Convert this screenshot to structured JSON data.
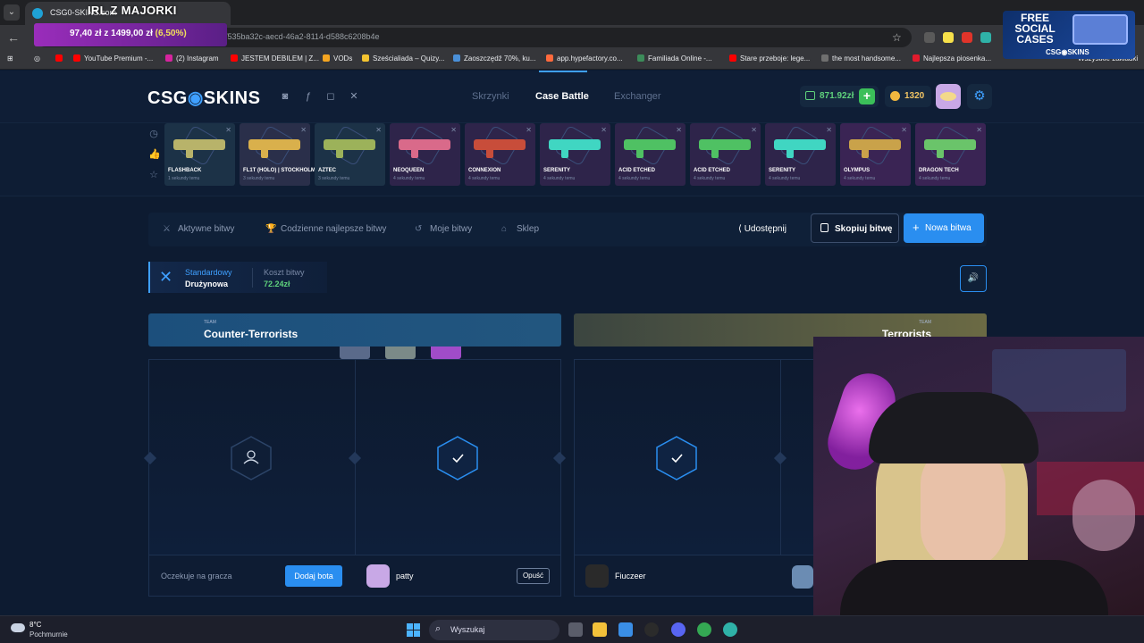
{
  "browser": {
    "tab_title": "CSG0-SKINS.com",
    "stream_overlay_title": "IRL Z MAJORKI",
    "url_partial": "battle/535ba32c-aecd-46a2-8114-d588c6208b4e",
    "donation": {
      "current": "97,40 zł",
      "mid": "z",
      "goal": "1499,00 zł",
      "percent": "(6,50%)"
    },
    "bookmarks": [
      {
        "label": "YouTube Premium -...",
        "color": "#ff0000"
      },
      {
        "label": "(2) Instagram",
        "color": "#d6249f"
      },
      {
        "label": "JESTEM DEBILEM | Z...",
        "color": "#ff0000"
      },
      {
        "label": "VODs",
        "color": "#f4a521"
      },
      {
        "label": "Sześcialiada – Quizy...",
        "color": "#f4c430"
      },
      {
        "label": "Zaoszczędź 70%, ku...",
        "color": "#4a90d9"
      },
      {
        "label": "app.hypefactory.co...",
        "color": "#ff6a3d"
      },
      {
        "label": "Familiada Online -...",
        "color": "#3c8c5a"
      },
      {
        "label": "Stare przeboje: lege...",
        "color": "#ff0000"
      },
      {
        "label": "the most handsome...",
        "color": "#6f6f6f"
      },
      {
        "label": "Najlepsza piosenka...",
        "color": "#e21b2d"
      }
    ],
    "bookmarks_all": "Wszystkie zakładki",
    "promo": {
      "line1": "FREE SOCIAL CASES",
      "brand": "CSG◉SKINS"
    }
  },
  "header": {
    "logo_left": "CSG",
    "logo_mid": "◉",
    "logo_right": "SKINS",
    "nav": [
      "Skrzynki",
      "Case Battle",
      "Exchanger"
    ],
    "balance": "871.92zł",
    "coins": "1320",
    "accent": "#3fa0ff"
  },
  "live_drops": [
    {
      "name": "FLASHBACK",
      "time": "1 sekundy temu",
      "color": "#b8b36a",
      "tint": "#1c3247"
    },
    {
      "name": "FL1T (HOLO) | STOCKHOLM 2021",
      "time": "3 sekundy temu",
      "color": "#d9b04c",
      "tint": "#2a2f4a"
    },
    {
      "name": "AZTEC",
      "time": "3 sekundy temu",
      "color": "#9cb25a",
      "tint": "#1c3247"
    },
    {
      "name": "NEOQUEEN",
      "time": "4 sekundy temu",
      "color": "#d96a8a",
      "tint": "#2e244a"
    },
    {
      "name": "CONNEXION",
      "time": "4 sekundy temu",
      "color": "#c84d3a",
      "tint": "#2e244a"
    },
    {
      "name": "SERENITY",
      "time": "4 sekundy temu",
      "color": "#40d6c2",
      "tint": "#2e244a"
    },
    {
      "name": "ACID ETCHED",
      "time": "4 sekundy temu",
      "color": "#4fc163",
      "tint": "#2e244a"
    },
    {
      "name": "ACID ETCHED",
      "time": "4 sekundy temu",
      "color": "#4fc163",
      "tint": "#2e244a"
    },
    {
      "name": "SERENITY",
      "time": "4 sekundy temu",
      "color": "#40d6c2",
      "tint": "#2e244a"
    },
    {
      "name": "OLYMPUS",
      "time": "4 sekundy temu",
      "color": "#c9a24a",
      "tint": "#3a2454"
    },
    {
      "name": "DRAGON TECH",
      "time": "4 sekundy temu",
      "color": "#6ac46a",
      "tint": "#3a2454"
    }
  ],
  "battle_tabs": {
    "active_battles": "Aktywne bitwy",
    "daily_best": "Codzienne najlepsze bitwy",
    "my_battles": "Moje bitwy",
    "shop": "Sklep",
    "share": "Udostępnij",
    "copy": "Skopiuj bitwę",
    "new": "Nowa bitwa"
  },
  "battle": {
    "mode_type": "Standardowy",
    "mode_name": "Drużynowa",
    "cost_label": "Koszt bitwy",
    "cost": "72.24zł",
    "cases": [
      {
        "color": "#5a6a8a"
      },
      {
        "color": "#7b8a88"
      },
      {
        "color": "#a04cc9"
      }
    ]
  },
  "teams": {
    "ct_label": "TEAM",
    "ct_name": "Counter-Terrorists",
    "t_label": "TEAM",
    "t_name": "Terrorists"
  },
  "players": {
    "waiting": "Oczekuje na gracza",
    "add_bot": "Dodaj bota",
    "p1": "patty",
    "leave": "Opuść",
    "p2": "Fiuczeer"
  },
  "taskbar": {
    "temp": "8°C",
    "condition": "Pochmurnie",
    "search": "Wyszukaj"
  }
}
